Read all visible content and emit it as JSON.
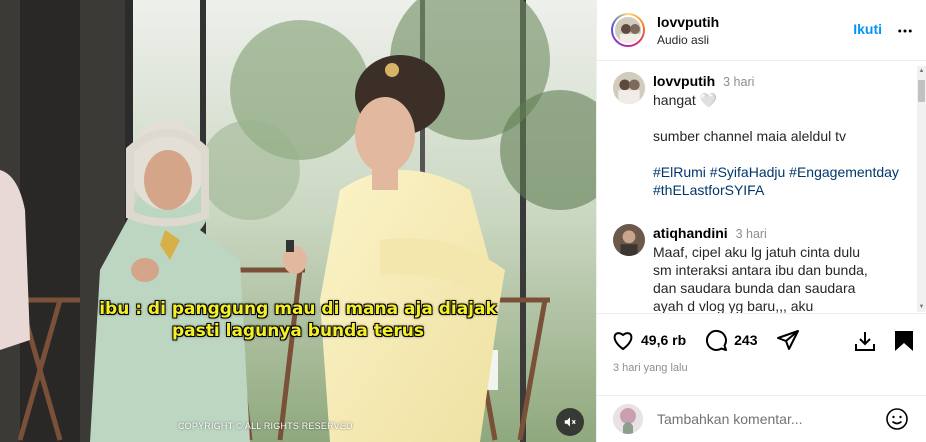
{
  "video": {
    "subtitle_line1": "ibu : di panggung mau di mana aja diajak",
    "subtitle_line2": "pasti lagunya bunda terus",
    "copyright": "COPYRIGHT © ALL RIGHTS RESERVED",
    "mute_icon": "speaker-muted-icon"
  },
  "header": {
    "username": "lovvputih",
    "audio": "Audio asli",
    "follow_label": "Ikuti",
    "more_icon": "more-horizontal-icon"
  },
  "caption": {
    "username": "lovvputih",
    "time": "3 hari",
    "line1": "hangat 🤍",
    "line2": "sumber channel maia aleldul tv",
    "hashtags_line1": "#ElRumi #SyifaHadju #Engagementday",
    "hashtags_line2": "#thELastforSYIFA"
  },
  "comments": [
    {
      "username": "atiqhandini",
      "time": "3 hari",
      "lines": [
        "Maaf, cipel aku lg jatuh cinta dulu",
        "sm interaksi antara ibu dan bunda,",
        "dan saudara bunda dan saudara",
        "ayah d vlog yg baru,,, aku"
      ]
    }
  ],
  "actions": {
    "likes": "49,6 rb",
    "comments": "243",
    "date": "3 hari yang lalu"
  },
  "add_comment": {
    "placeholder": "Tambahkan komentar..."
  },
  "colors": {
    "follow": "#0095f6",
    "subtitle": "#f5ef2a",
    "hashtag": "#00376b"
  }
}
